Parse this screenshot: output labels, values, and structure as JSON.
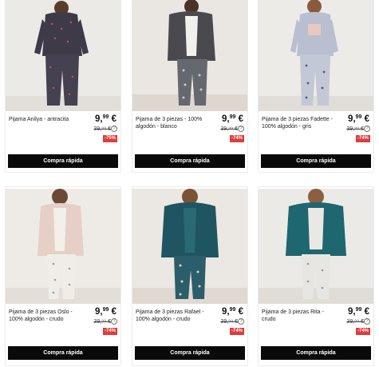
{
  "currency_note": "EUR",
  "products": [
    {
      "name": "Pijama Anilya - antracita",
      "price_main": "9,",
      "price_cents": "99",
      "price_currency": "€",
      "old_price": "39,⁹⁹ €",
      "discount": "-75%",
      "cta": "Compra rápida",
      "info_glyph": "?"
    },
    {
      "name": "Pijama de 3 piezas - 100% algodón - blanco",
      "price_main": "9,",
      "price_cents": "99",
      "price_currency": "€",
      "old_price": "39,⁹⁹ €",
      "discount": "-74%",
      "cta": "Compra rápida",
      "info_glyph": "?"
    },
    {
      "name": "Pijama de 3 piezas Fadette - 100% algodón - gris",
      "price_main": "9,",
      "price_cents": "99",
      "price_currency": "€",
      "old_price": "39,⁹⁹ €",
      "discount": "-74%",
      "cta": "Compra rápida",
      "info_glyph": "?"
    },
    {
      "name": "Pijama de 3 piezas Oslo - 100% algodón - crudo",
      "price_main": "9,",
      "price_cents": "99",
      "price_currency": "€",
      "old_price": "39,⁹⁹ €",
      "discount": "-74%",
      "cta": "Compra rápida",
      "info_glyph": "?"
    },
    {
      "name": "Pijama de 3 piezas Rafael - 100% algodón - crudo",
      "price_main": "9,",
      "price_cents": "99",
      "price_currency": "€",
      "old_price": "39,⁹⁹ €",
      "discount": "-74%",
      "cta": "Compra rápida",
      "info_glyph": "?"
    },
    {
      "name": "Pijama de 3 piezas Rita - crudo",
      "price_main": "9,",
      "price_cents": "99",
      "price_currency": "€",
      "old_price": "39,⁹⁹ €",
      "discount": "-74%",
      "cta": "Compra rápida",
      "info_glyph": "?"
    }
  ],
  "colors": {
    "button_bg": "#0a0a0a",
    "discount_badge": "#e03b3b",
    "card_border": "#ebebeb"
  }
}
